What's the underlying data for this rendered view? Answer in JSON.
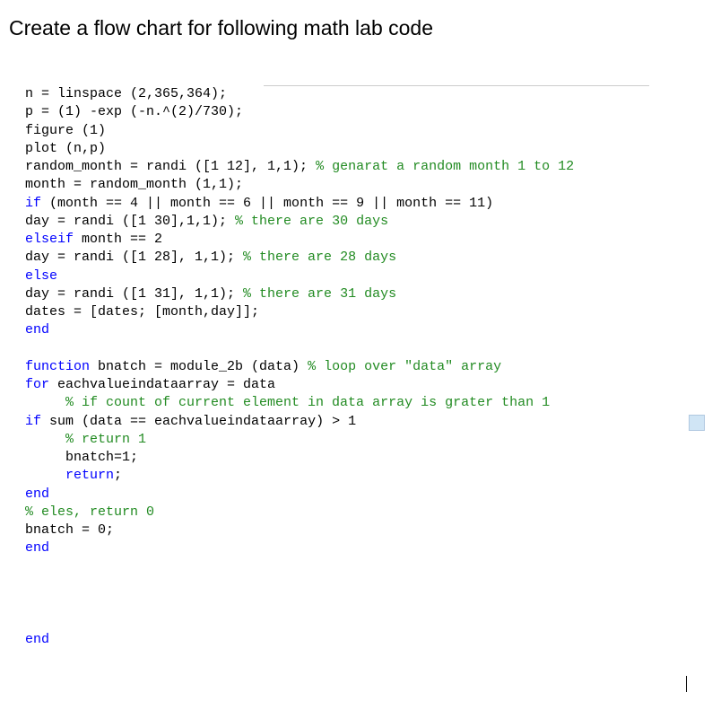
{
  "title": "Create a flow chart for following math lab code",
  "code_block1": {
    "l1a": "n = linspace (2,365,364);",
    "l2a": "p = (1) -exp (-n.^(2)/730);",
    "l3a": "figure (1)",
    "l4a": "plot (n,p)",
    "l5a": "random_month = randi ([1 12], 1,1); ",
    "l5b": "% genarat a random month 1 to 12",
    "l6a": "month = random_month (1,1);",
    "l7a": "if",
    "l7b": " (month == 4 || month == 6 || month == 9 || month == 11)",
    "l8a": "day = randi ([1 30],1,1); ",
    "l8b": "% there are 30 days",
    "l9a": "elseif",
    "l9b": " month == 2",
    "l10a": "day = randi ([1 28], 1,1); ",
    "l10b": "% there are 28 days",
    "l11a": "else",
    "l12a": "day = randi ([1 31], 1,1); ",
    "l12b": "% there are 31 days",
    "l13a": "dates = [dates; [month,day]];",
    "l14a": "end"
  },
  "code_block2": {
    "l1a": "function",
    "l1b": " bnatch = module_2b (data) ",
    "l1c": "% loop over \"data\" array",
    "l2a": "for",
    "l2b": " eachvalueindataarray = data",
    "l3a": "     % if count of current element in data array is grater than 1",
    "l4a": "if",
    "l4b": " sum (data == eachvalueindataarray) > 1",
    "l5a": "     % return 1",
    "l6a": "     bnatch=1;",
    "l7a": "     ",
    "l7b": "return",
    "l7c": ";",
    "l8a": "end",
    "l9a": "% eles, return 0",
    "l10a": "bnatch = 0;",
    "l11a": "end",
    "l12a": "end"
  }
}
